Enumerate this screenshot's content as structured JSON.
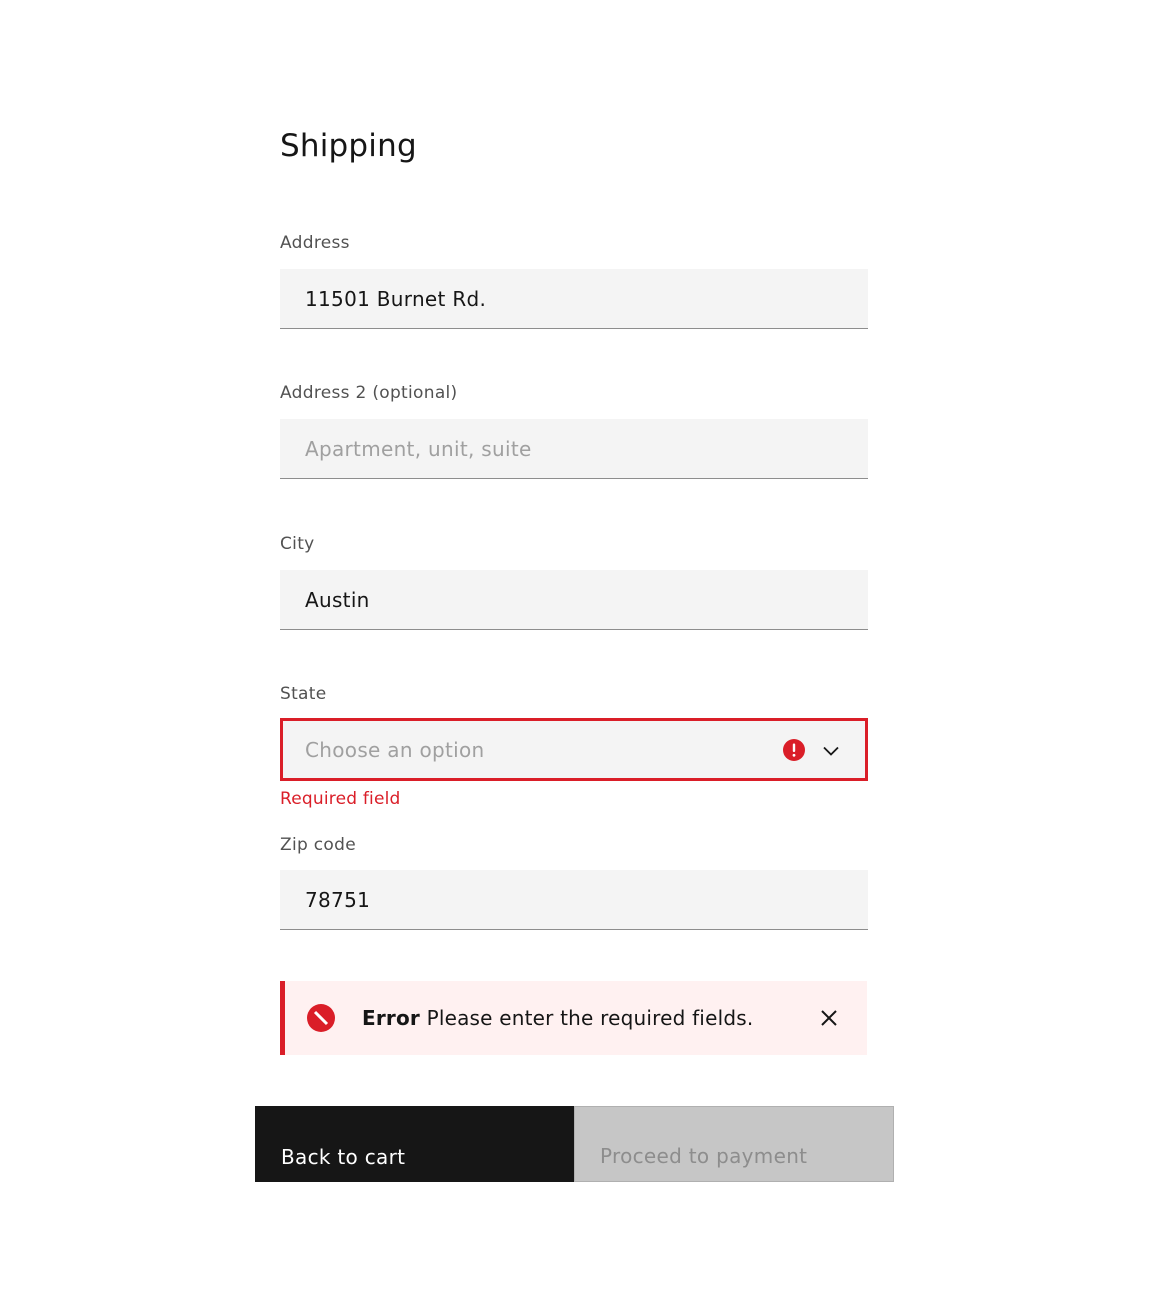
{
  "page": {
    "title": "Shipping"
  },
  "fields": {
    "address": {
      "label": "Address",
      "value": "11501 Burnet Rd.",
      "placeholder": ""
    },
    "address2": {
      "label": "Address 2 (optional)",
      "value": "",
      "placeholder": "Apartment, unit, suite"
    },
    "city": {
      "label": "City",
      "value": "Austin",
      "placeholder": ""
    },
    "state": {
      "label": "State",
      "placeholder": "Choose an option",
      "error": "Required field",
      "icons": [
        "warning-filled-icon",
        "chevron-down-icon"
      ]
    },
    "zip": {
      "label": "Zip code",
      "value": "78751",
      "placeholder": ""
    }
  },
  "notification": {
    "kind": "error",
    "title": "Error",
    "message": "Please enter the required fields.",
    "icons": [
      "error-filled-icon",
      "close-icon"
    ]
  },
  "buttons": {
    "back": "Back to cart",
    "proceed": "Proceed to payment",
    "proceed_disabled": true
  },
  "colors": {
    "error": "#da1e28",
    "error_background": "#fff1f1",
    "field_background": "#f4f4f4",
    "primary_button": "#161616",
    "disabled_button": "#c6c6c6",
    "text": "#161616",
    "label": "#525252"
  }
}
